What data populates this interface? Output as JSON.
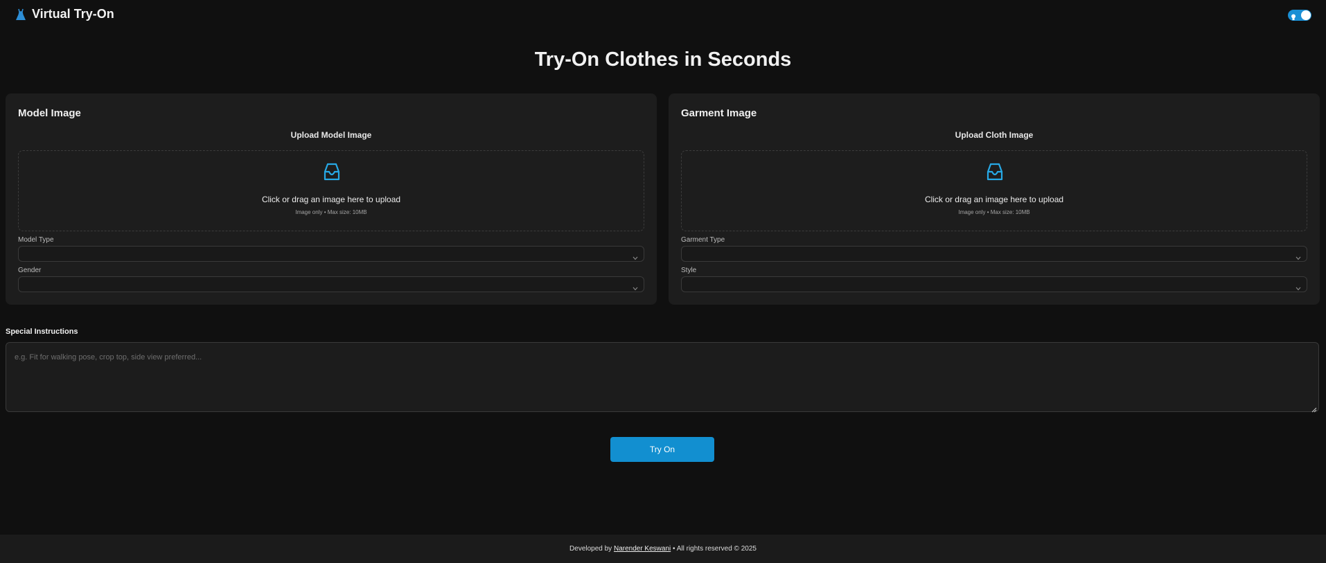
{
  "header": {
    "app_title": "Virtual Try-On",
    "logo_icon": "dress-icon",
    "theme_toggle_icon": "lightbulb-icon",
    "theme_toggle_on": true,
    "accent_color": "#1a8fd4"
  },
  "hero": {
    "title": "Try-On Clothes in Seconds"
  },
  "model_card": {
    "title": "Model Image",
    "upload_label": "Upload Model Image",
    "dropzone_text": "Click or drag an image here to upload",
    "dropzone_hint": "Image only • Max size: 10MB",
    "dropzone_icon": "inbox-icon",
    "fields": [
      {
        "label": "Model Type",
        "value": ""
      },
      {
        "label": "Gender",
        "value": ""
      }
    ]
  },
  "garment_card": {
    "title": "Garment Image",
    "upload_label": "Upload Cloth Image",
    "dropzone_text": "Click or drag an image here to upload",
    "dropzone_hint": "Image only • Max size: 10MB",
    "dropzone_icon": "inbox-icon",
    "fields": [
      {
        "label": "Garment Type",
        "value": ""
      },
      {
        "label": "Style",
        "value": ""
      }
    ]
  },
  "instructions": {
    "label": "Special Instructions",
    "placeholder": "e.g. Fit for walking pose, crop top, side view preferred...",
    "value": ""
  },
  "actions": {
    "try_on_label": "Try On",
    "button_color": "#128fd0"
  },
  "footer": {
    "prefix": "Developed by",
    "author": "Narender Keswani",
    "suffix": "• All rights reserved © 2025"
  }
}
